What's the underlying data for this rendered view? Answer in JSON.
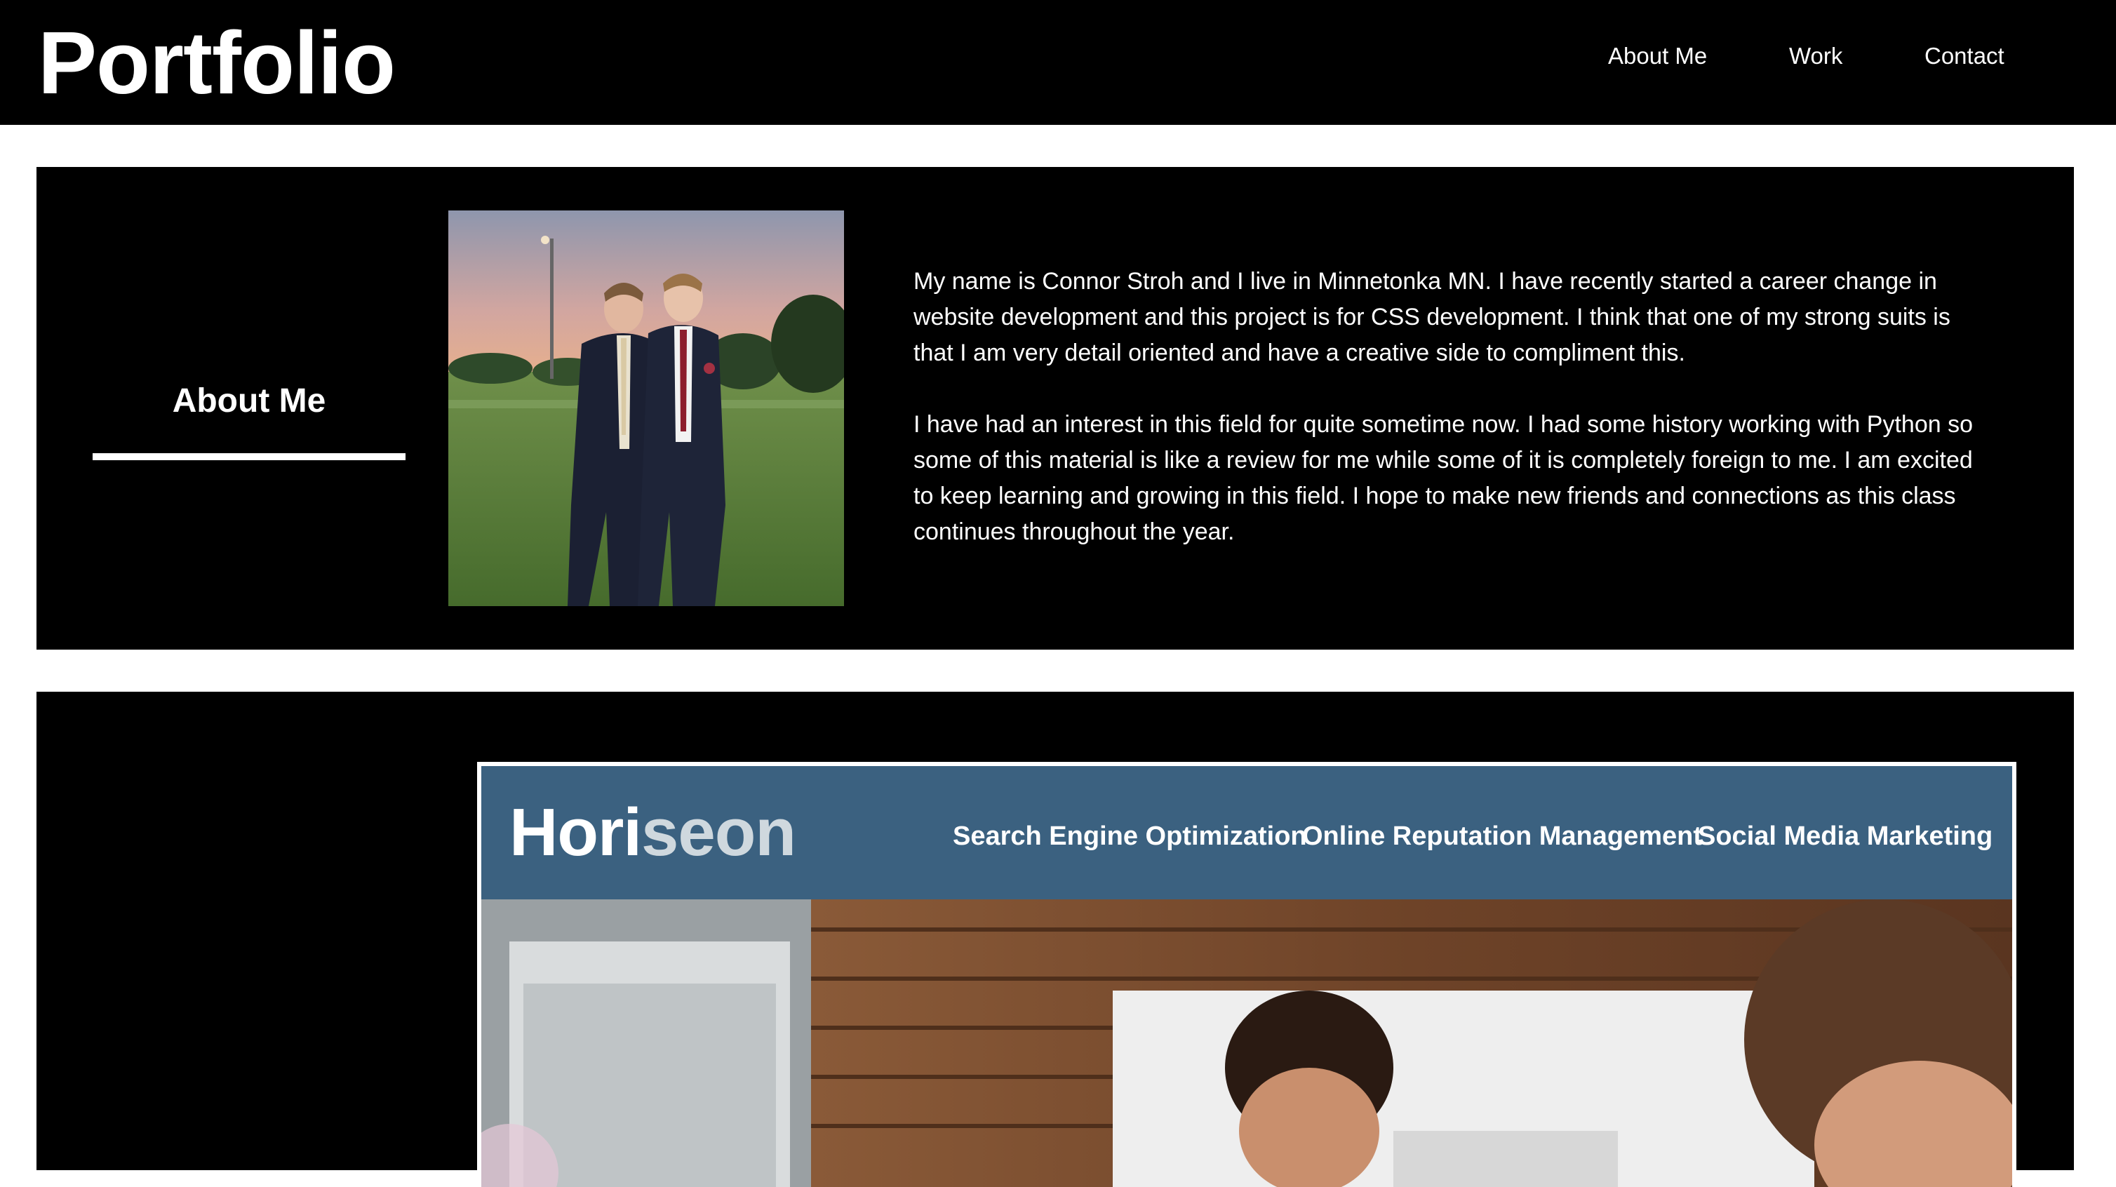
{
  "header": {
    "logo": "Portfolio",
    "nav": [
      "About Me",
      "Work",
      "Contact"
    ]
  },
  "about": {
    "heading": "About Me",
    "paragraphs": [
      "My name is Connor Stroh and I live in Minnetonka MN. I have recently started a career change in website development and this project is for CSS development. I think that one of my strong suits is that I am very detail oriented and have a creative side to compliment this.",
      "I have had an interest in this field for quite sometime now. I had some history working with Python so some of this material is like a review for me while some of it is completely foreign to me. I am excited to keep learning and growing in this field. I hope to make new friends and connections as this class continues throughout the year."
    ]
  },
  "work": {
    "project": {
      "brand_dark": "Hori",
      "brand_light": "seon",
      "nav": [
        "Search Engine Optimization",
        "Online Reputation Management",
        "Social Media Marketing"
      ]
    }
  },
  "colors": {
    "header_bg": "#000000",
    "section_bg": "#000000",
    "project_header": "#3b6180"
  }
}
